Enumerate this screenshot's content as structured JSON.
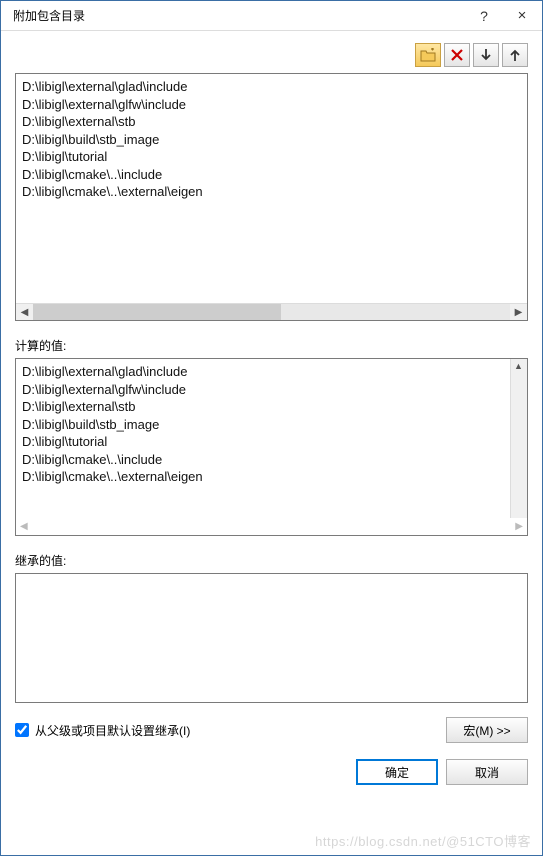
{
  "titlebar": {
    "title": "附加包含目录",
    "help": "?",
    "close": "×"
  },
  "toolbar": {
    "folder": "📁",
    "delete": "✕",
    "down": "↓",
    "up": "↑"
  },
  "editbox": {
    "lines": "D:\\libigl\\external\\glad\\include\nD:\\libigl\\external\\glfw\\include\nD:\\libigl\\external\\stb\nD:\\libigl\\build\\stb_image\nD:\\libigl\\tutorial\nD:\\libigl\\cmake\\..\\include\nD:\\libigl\\cmake\\..\\external\\eigen"
  },
  "calc": {
    "label": "计算的值:",
    "lines": "D:\\libigl\\external\\glad\\include\nD:\\libigl\\external\\glfw\\include\nD:\\libigl\\external\\stb\nD:\\libigl\\build\\stb_image\nD:\\libigl\\tutorial\nD:\\libigl\\cmake\\..\\include\nD:\\libigl\\cmake\\..\\external\\eigen"
  },
  "inherit": {
    "label": "继承的值:"
  },
  "checkbox": {
    "label": "从父级或项目默认设置继承(I)"
  },
  "buttons": {
    "macro": "宏(M) >>",
    "ok": "确定",
    "cancel": "取消"
  },
  "watermark": "https://blog.csdn.net/@51CTO博客"
}
